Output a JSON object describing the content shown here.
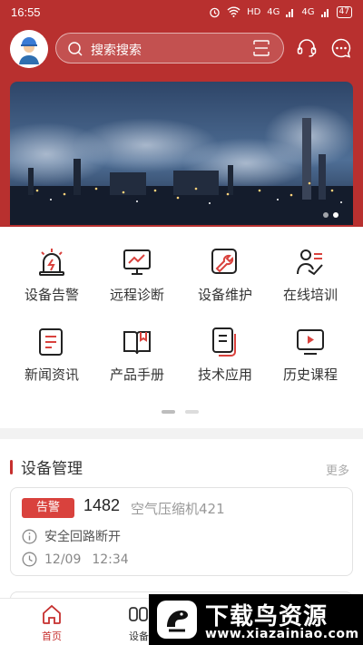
{
  "status_bar": {
    "time": "16:55",
    "network": "HD",
    "signal1": "4G",
    "signal2": "4G",
    "battery": "47"
  },
  "search": {
    "placeholder": "搜索搜索"
  },
  "menu": {
    "items": [
      {
        "label": "设备告警",
        "icon": "alarm-icon"
      },
      {
        "label": "远程诊断",
        "icon": "monitor-chart-icon"
      },
      {
        "label": "设备维护",
        "icon": "wrench-icon"
      },
      {
        "label": "在线培训",
        "icon": "teacher-icon"
      },
      {
        "label": "新闻资讯",
        "icon": "news-icon"
      },
      {
        "label": "产品手册",
        "icon": "book-icon"
      },
      {
        "label": "技术应用",
        "icon": "document-stack-icon"
      },
      {
        "label": "历史课程",
        "icon": "video-play-icon"
      }
    ]
  },
  "section": {
    "title": "设备管理",
    "more": "更多"
  },
  "device_card": {
    "tag": "告警",
    "number": "1482",
    "name": "空气压缩机421",
    "message": "安全回路断开",
    "date": "12/09",
    "time": "12:34"
  },
  "tabbar": {
    "home": "首页",
    "device": "设备"
  },
  "watermark": {
    "title": "下载鸟资源",
    "url": "www.xiazainiao.com"
  },
  "colors": {
    "brand_red": "#b8302f",
    "icon_red": "#d9423d",
    "tag_red": "#d9423d"
  }
}
